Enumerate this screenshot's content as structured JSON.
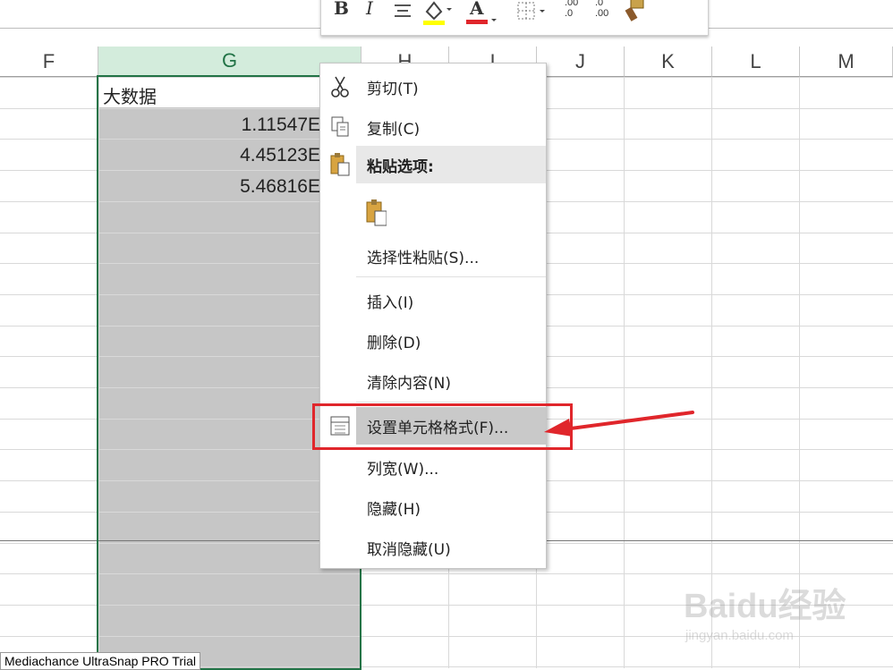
{
  "columns": [
    "F",
    "G",
    "H",
    "I",
    "J",
    "K",
    "L",
    "M"
  ],
  "selected_column": "G",
  "cells": {
    "header": "大数据",
    "values": [
      "1.11547E",
      "4.45123E",
      "5.46816E"
    ]
  },
  "mini_toolbar": {
    "bold": "B",
    "italic": "I",
    "font_color": "A",
    "increase_decimal": ".00\n.0",
    "decrease_decimal": ".0\n.00"
  },
  "context_menu": {
    "cut": "剪切(T)",
    "copy": "复制(C)",
    "paste_options": "粘贴选项:",
    "paste_special": "选择性粘贴(S)...",
    "insert": "插入(I)",
    "delete": "删除(D)",
    "clear_contents": "清除内容(N)",
    "format_cells": "设置单元格格式(F)...",
    "column_width": "列宽(W)...",
    "hide": "隐藏(H)",
    "unhide": "取消隐藏(U)"
  },
  "trial_label": "Mediachance UltraSnap PRO Trial",
  "watermark": {
    "brand": "Baidu经验",
    "url": "jingyan.baidu.com"
  },
  "colors": {
    "accent": "#217346",
    "highlight_box": "#e0262b",
    "arrow": "#e0262b"
  }
}
